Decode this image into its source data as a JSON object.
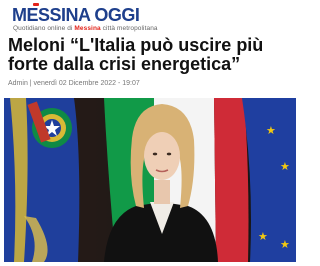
{
  "site": {
    "logo_part1": "ME",
    "logo_part2": "SSINA OGGI",
    "tagline_prefix": "Quotidiano online di ",
    "tagline_city": "Messina",
    "tagline_suffix": " città metropolitana"
  },
  "article": {
    "title": "Meloni “L'Italia può uscire più forte dalla crisi energetica”",
    "meta": "Admin | venerdì 02 Dicembre 2022 - 19:07"
  },
  "colors": {
    "brand_blue": "#1e3f8c",
    "accent_red": "#e2231a",
    "flag_green": "#119a48",
    "flag_red": "#cf2b37",
    "eu_blue": "#1f3fa0"
  },
  "icons": {
    "photo": "eu-flag-and-italian-flag-photo"
  }
}
